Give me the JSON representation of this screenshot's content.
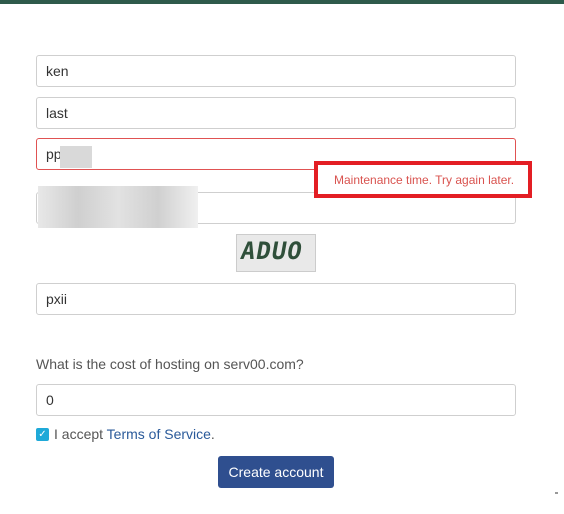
{
  "form": {
    "first_name": "ken",
    "last_name": "last",
    "username": "pp",
    "captcha_text": "ADUO",
    "captcha_answer": "pxii",
    "question": "What is the cost of hosting on serv00.com?",
    "answer": "0",
    "accept_prefix": "I accept",
    "terms_link": "Terms of Service",
    "accept_suffix": ".",
    "submit_label": "Create account",
    "checkbox_checked": true
  },
  "tooltip": {
    "message": "Maintenance time. Try again later."
  },
  "colors": {
    "accent": "#2f4f8f",
    "error": "#d9534f",
    "highlight": "#e31e24",
    "checkbox": "#1fa9d8",
    "topbar": "#2e5a4b"
  },
  "icons": {
    "checkbox": "check-icon"
  }
}
